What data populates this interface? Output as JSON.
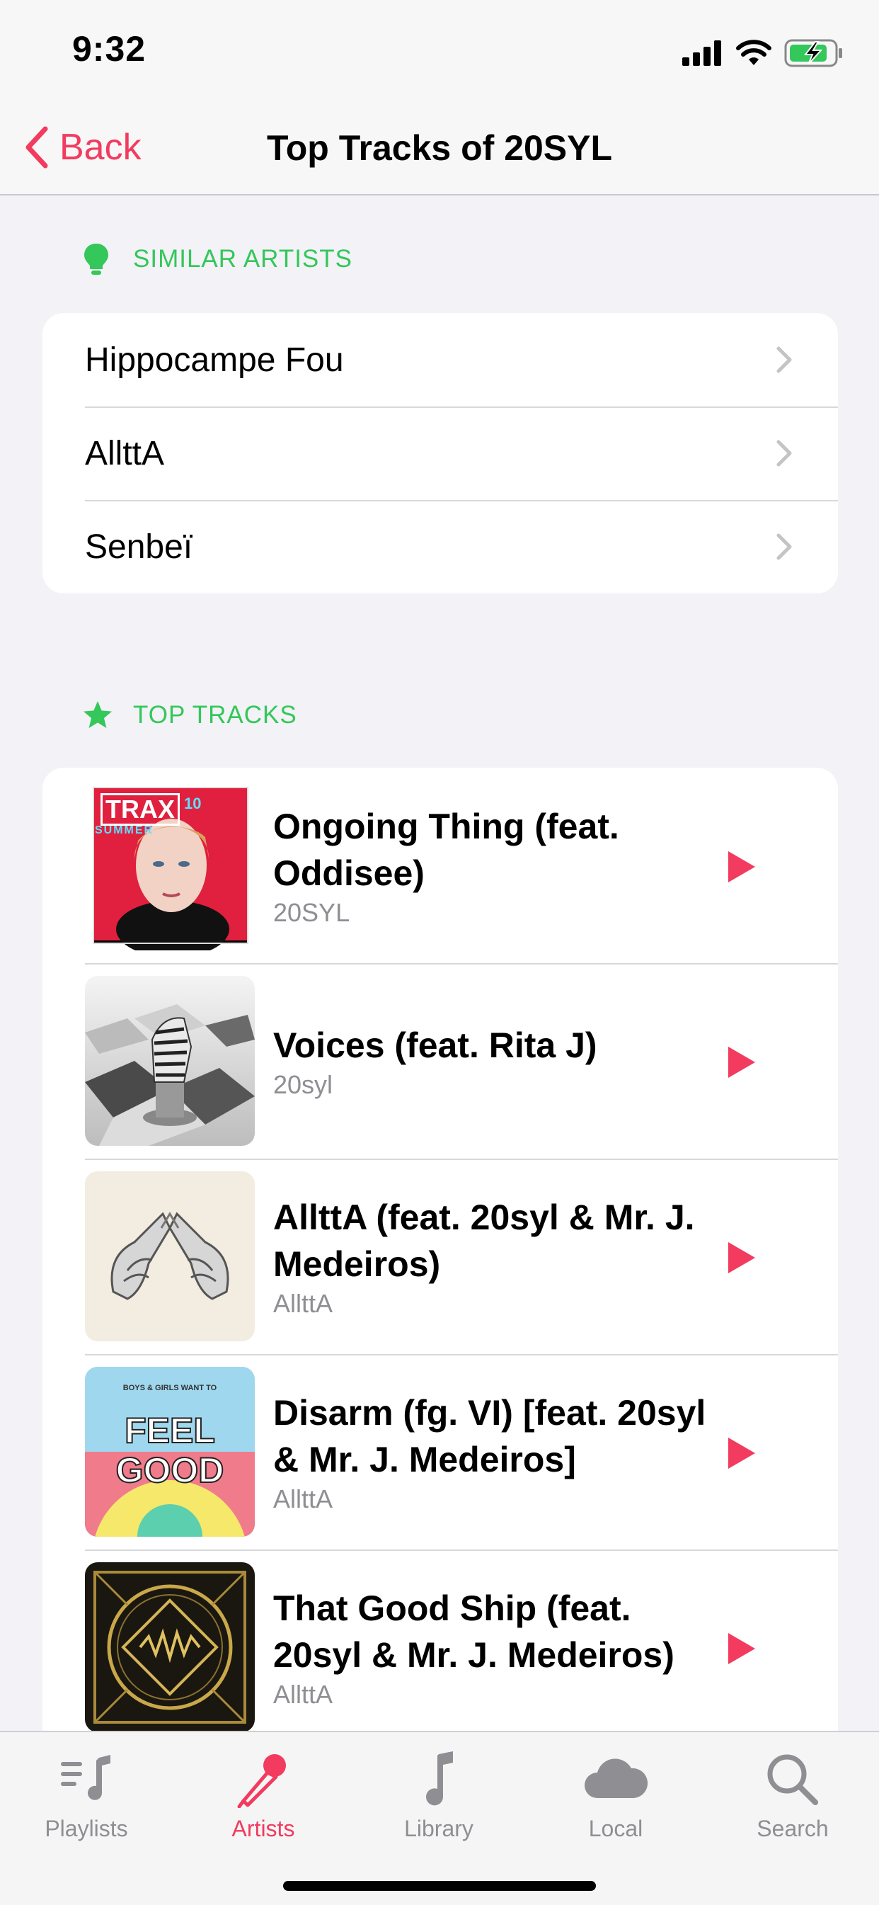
{
  "status_bar": {
    "time": "9:32"
  },
  "nav": {
    "back_label": "Back",
    "title": "Top Tracks of 20SYL"
  },
  "similar_artists": {
    "header": "SIMILAR ARTISTS",
    "items": [
      {
        "name": "Hippocampe Fou"
      },
      {
        "name": "AllttA"
      },
      {
        "name": "Senbeï"
      }
    ]
  },
  "top_tracks": {
    "header": "TOP TRACKS",
    "items": [
      {
        "title": "Ongoing Thing (feat. Oddisee)",
        "artist": "20SYL",
        "art_text": "TRAX",
        "art_subtext": "SUMMER",
        "art_num": "10"
      },
      {
        "title": "Voices (feat. Rita J)",
        "artist": "20syl"
      },
      {
        "title": "AllttA (feat. 20syl & Mr. J. Medeiros)",
        "artist": "AllttA"
      },
      {
        "title": "Disarm (fg. VI) [feat. 20syl & Mr. J. Medeiros]",
        "artist": "AllttA",
        "art_small": "BOYS & GIRLS WANT TO",
        "art_big1": "FEEL",
        "art_big2": "GOOD"
      },
      {
        "title": "That Good Ship (feat. 20syl & Mr. J. Medeiros)",
        "artist": "AllttA"
      }
    ]
  },
  "tab_bar": {
    "tabs": [
      {
        "label": "Playlists",
        "icon": "playlists-icon"
      },
      {
        "label": "Artists",
        "icon": "microphone-icon",
        "active": true
      },
      {
        "label": "Library",
        "icon": "music-note-icon"
      },
      {
        "label": "Local",
        "icon": "cloud-icon"
      },
      {
        "label": "Search",
        "icon": "search-icon"
      }
    ]
  },
  "colors": {
    "accent": "#f23b5f",
    "section_green": "#34c759",
    "inactive_gray": "#8e8e93"
  }
}
